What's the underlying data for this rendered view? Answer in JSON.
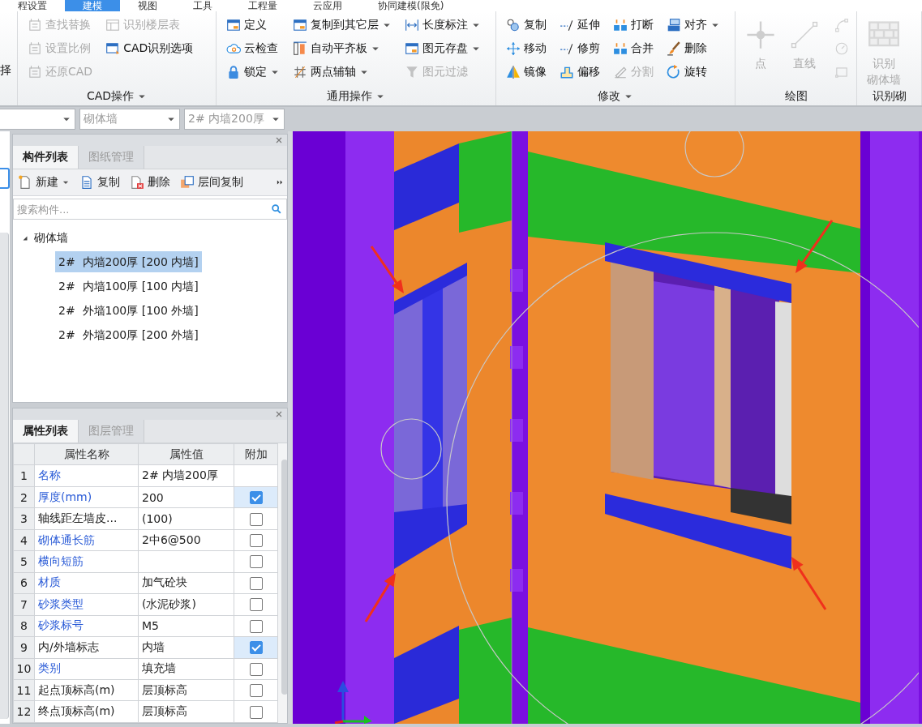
{
  "ribbon_tabs": [
    {
      "label": "程设置",
      "selected": false
    },
    {
      "label": "建模",
      "selected": true
    },
    {
      "label": "视图",
      "selected": false
    },
    {
      "label": "工具",
      "selected": false
    },
    {
      "label": "工程量",
      "selected": false
    },
    {
      "label": "云应用",
      "selected": false
    },
    {
      "label": "协同建模(限免)",
      "selected": false
    }
  ],
  "ribbon_groups": [
    {
      "columns": [
        [
          {
            "kind": "small",
            "label": "择",
            "disabled": false,
            "dropdown": false
          }
        ]
      ]
    },
    {
      "label": "CAD操作",
      "columns": [
        [
          {
            "kind": "small",
            "label": "查找替换",
            "disabled": true,
            "dropdown": false
          },
          {
            "kind": "small",
            "label": "设置比例",
            "disabled": true,
            "dropdown": false
          },
          {
            "kind": "small",
            "label": "还原CAD",
            "disabled": true,
            "dropdown": false
          }
        ],
        [
          {
            "kind": "small",
            "label": "识别楼层表",
            "disabled": true,
            "dropdown": false
          },
          {
            "kind": "small",
            "label": "CAD识别选项",
            "disabled": false,
            "dropdown": false
          }
        ]
      ]
    },
    {
      "label": "通用操作",
      "columns": [
        [
          {
            "kind": "small",
            "label": "定义",
            "disabled": false,
            "dropdown": false
          },
          {
            "kind": "small",
            "label": "云检查",
            "disabled": false,
            "dropdown": false
          },
          {
            "kind": "small",
            "label": "锁定",
            "disabled": false,
            "dropdown": true
          }
        ],
        [
          {
            "kind": "small",
            "label": "复制到其它层",
            "disabled": false,
            "dropdown": true
          },
          {
            "kind": "small",
            "label": "自动平齐板",
            "disabled": false,
            "dropdown": true
          },
          {
            "kind": "small",
            "label": "两点辅轴",
            "disabled": false,
            "dropdown": true
          }
        ],
        [
          {
            "kind": "small",
            "label": "长度标注",
            "disabled": false,
            "dropdown": true
          },
          {
            "kind": "small",
            "label": "图元存盘",
            "disabled": false,
            "dropdown": true
          },
          {
            "kind": "small",
            "label": "图元过滤",
            "disabled": true,
            "dropdown": false
          }
        ]
      ]
    },
    {
      "label": "修改",
      "columns": [
        [
          {
            "kind": "small",
            "label": "复制",
            "disabled": false,
            "dropdown": false
          },
          {
            "kind": "small",
            "label": "移动",
            "disabled": false,
            "dropdown": false
          },
          {
            "kind": "small",
            "label": "镜像",
            "disabled": false,
            "dropdown": false
          }
        ],
        [
          {
            "kind": "small",
            "label": "延伸",
            "disabled": false,
            "dropdown": false
          },
          {
            "kind": "small",
            "label": "修剪",
            "disabled": false,
            "dropdown": false
          },
          {
            "kind": "small",
            "label": "偏移",
            "disabled": false,
            "dropdown": false
          }
        ],
        [
          {
            "kind": "small",
            "label": "打断",
            "disabled": false,
            "dropdown": false
          },
          {
            "kind": "small",
            "label": "合并",
            "disabled": false,
            "dropdown": false
          },
          {
            "kind": "small",
            "label": "分割",
            "disabled": true,
            "dropdown": false
          }
        ],
        [
          {
            "kind": "small",
            "label": "对齐",
            "disabled": false,
            "dropdown": true
          },
          {
            "kind": "small",
            "label": "删除",
            "disabled": false,
            "dropdown": false
          },
          {
            "kind": "small",
            "label": "旋转",
            "disabled": false,
            "dropdown": false
          }
        ]
      ]
    },
    {
      "label": "绘图",
      "columns": [
        [
          {
            "kind": "large",
            "label": "点",
            "disabled": true,
            "dropdown": false
          }
        ],
        [
          {
            "kind": "large",
            "label": "直线",
            "disabled": true,
            "dropdown": false
          }
        ],
        [
          {
            "kind": "icon",
            "disabled": true
          },
          {
            "kind": "icon",
            "disabled": true
          },
          {
            "kind": "icon",
            "disabled": true
          }
        ]
      ]
    },
    {
      "label": "识别砌",
      "columns": [
        [
          {
            "kind": "large",
            "lines": [
              "识别",
              "砌体墙"
            ],
            "disabled": true,
            "dropdown": false
          }
        ]
      ]
    }
  ],
  "selectors": [
    {
      "disabled": true
    },
    {
      "value": "砌体墙",
      "disabled": true
    },
    {
      "value": "2#  内墙200厚",
      "disabled": true
    }
  ],
  "component_panel": {
    "tabs": [
      {
        "label": "构件列表",
        "selected": true
      },
      {
        "label": "图纸管理",
        "selected": false
      }
    ],
    "toolbar": [
      {
        "label": "新建",
        "dropdown": true
      },
      {
        "label": "复制",
        "dropdown": false
      },
      {
        "label": "删除",
        "dropdown": false
      },
      {
        "label": "层间复制",
        "dropdown": false
      }
    ],
    "search": {
      "placeholder": "搜索构件..."
    },
    "tree": [
      {
        "label": "砌体墙",
        "expanded": true,
        "children": [
          {
            "label": "2#  内墙200厚 [200 内墙]",
            "selected": true
          },
          {
            "label": "2#  内墙100厚 [100 内墙]",
            "selected": false
          },
          {
            "label": "2#  外墙100厚 [100 外墙]",
            "selected": false
          },
          {
            "label": "2#  外墙200厚 [200 外墙]",
            "selected": false
          }
        ]
      }
    ]
  },
  "property_panel": {
    "tabs": [
      {
        "label": "属性列表",
        "selected": true
      },
      {
        "label": "图层管理",
        "selected": false
      }
    ],
    "columns": [
      "属性名称",
      "属性值",
      "附加"
    ],
    "rows": [
      {
        "index": "1",
        "name": "名称",
        "value": "2#  内墙200厚",
        "public": true
      },
      {
        "index": "2",
        "name": "厚度(mm)",
        "value": "200",
        "public": true,
        "checked": true
      },
      {
        "index": "3",
        "name": "轴线距左墙皮...",
        "value": "(100)",
        "public": false,
        "checked": false
      },
      {
        "index": "4",
        "name": "砌体通长筋",
        "value": "2中6@500",
        "public": true,
        "checked": false
      },
      {
        "index": "5",
        "name": "横向短筋",
        "public": true,
        "checked": false
      },
      {
        "index": "6",
        "name": "材质",
        "value": "加气砼块",
        "public": true,
        "checked": false
      },
      {
        "index": "7",
        "name": "砂浆类型",
        "value": "(水泥砂浆)",
        "public": true,
        "checked": false
      },
      {
        "index": "8",
        "name": "砂浆标号",
        "value": "M5",
        "public": true,
        "checked": false
      },
      {
        "index": "9",
        "name": "内/外墙标志",
        "value": "内墙",
        "public": false,
        "checked": true
      },
      {
        "index": "10",
        "name": "类别",
        "value": "填充墙",
        "public": true,
        "checked": false
      },
      {
        "index": "11",
        "name": "起点顶标高(m)",
        "value": "层顶标高",
        "public": false,
        "checked": false
      },
      {
        "index": "12",
        "name": "终点顶标高(m)",
        "value": "层顶标高",
        "public": false,
        "checked": false
      }
    ]
  }
}
